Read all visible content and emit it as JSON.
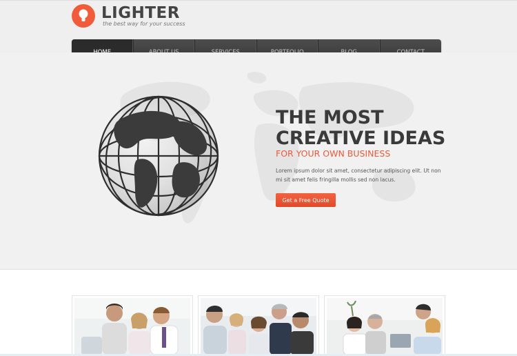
{
  "brand": {
    "title": "LIGHTER",
    "tagline": "the best way for your success",
    "logo_icon": "lightbulb-icon",
    "accent_color": "#f15a3a"
  },
  "nav": {
    "items": [
      {
        "label": "HOME",
        "active": true
      },
      {
        "label": "ABOUT US",
        "active": false
      },
      {
        "label": "SERVICES",
        "active": false
      },
      {
        "label": "PORTFOLIO",
        "active": false
      },
      {
        "label": "BLOG",
        "active": false
      },
      {
        "label": "CONTACT",
        "active": false
      }
    ]
  },
  "hero": {
    "title_line1": "THE MOST",
    "title_line2": "CREATIVE IDEAS",
    "subtitle": "FOR YOUR OWN BUSINESS",
    "text": "Lorem ipsum dolor sit amet, consectetur adipiscing elit. Ut non mi sit amet felis fringilla mollis sed non lacus.",
    "cta_label": "Get a Free Quote",
    "image": "globe-image"
  },
  "photos": [
    {
      "name": "team-photo-1"
    },
    {
      "name": "team-photo-2"
    },
    {
      "name": "team-photo-3"
    }
  ]
}
